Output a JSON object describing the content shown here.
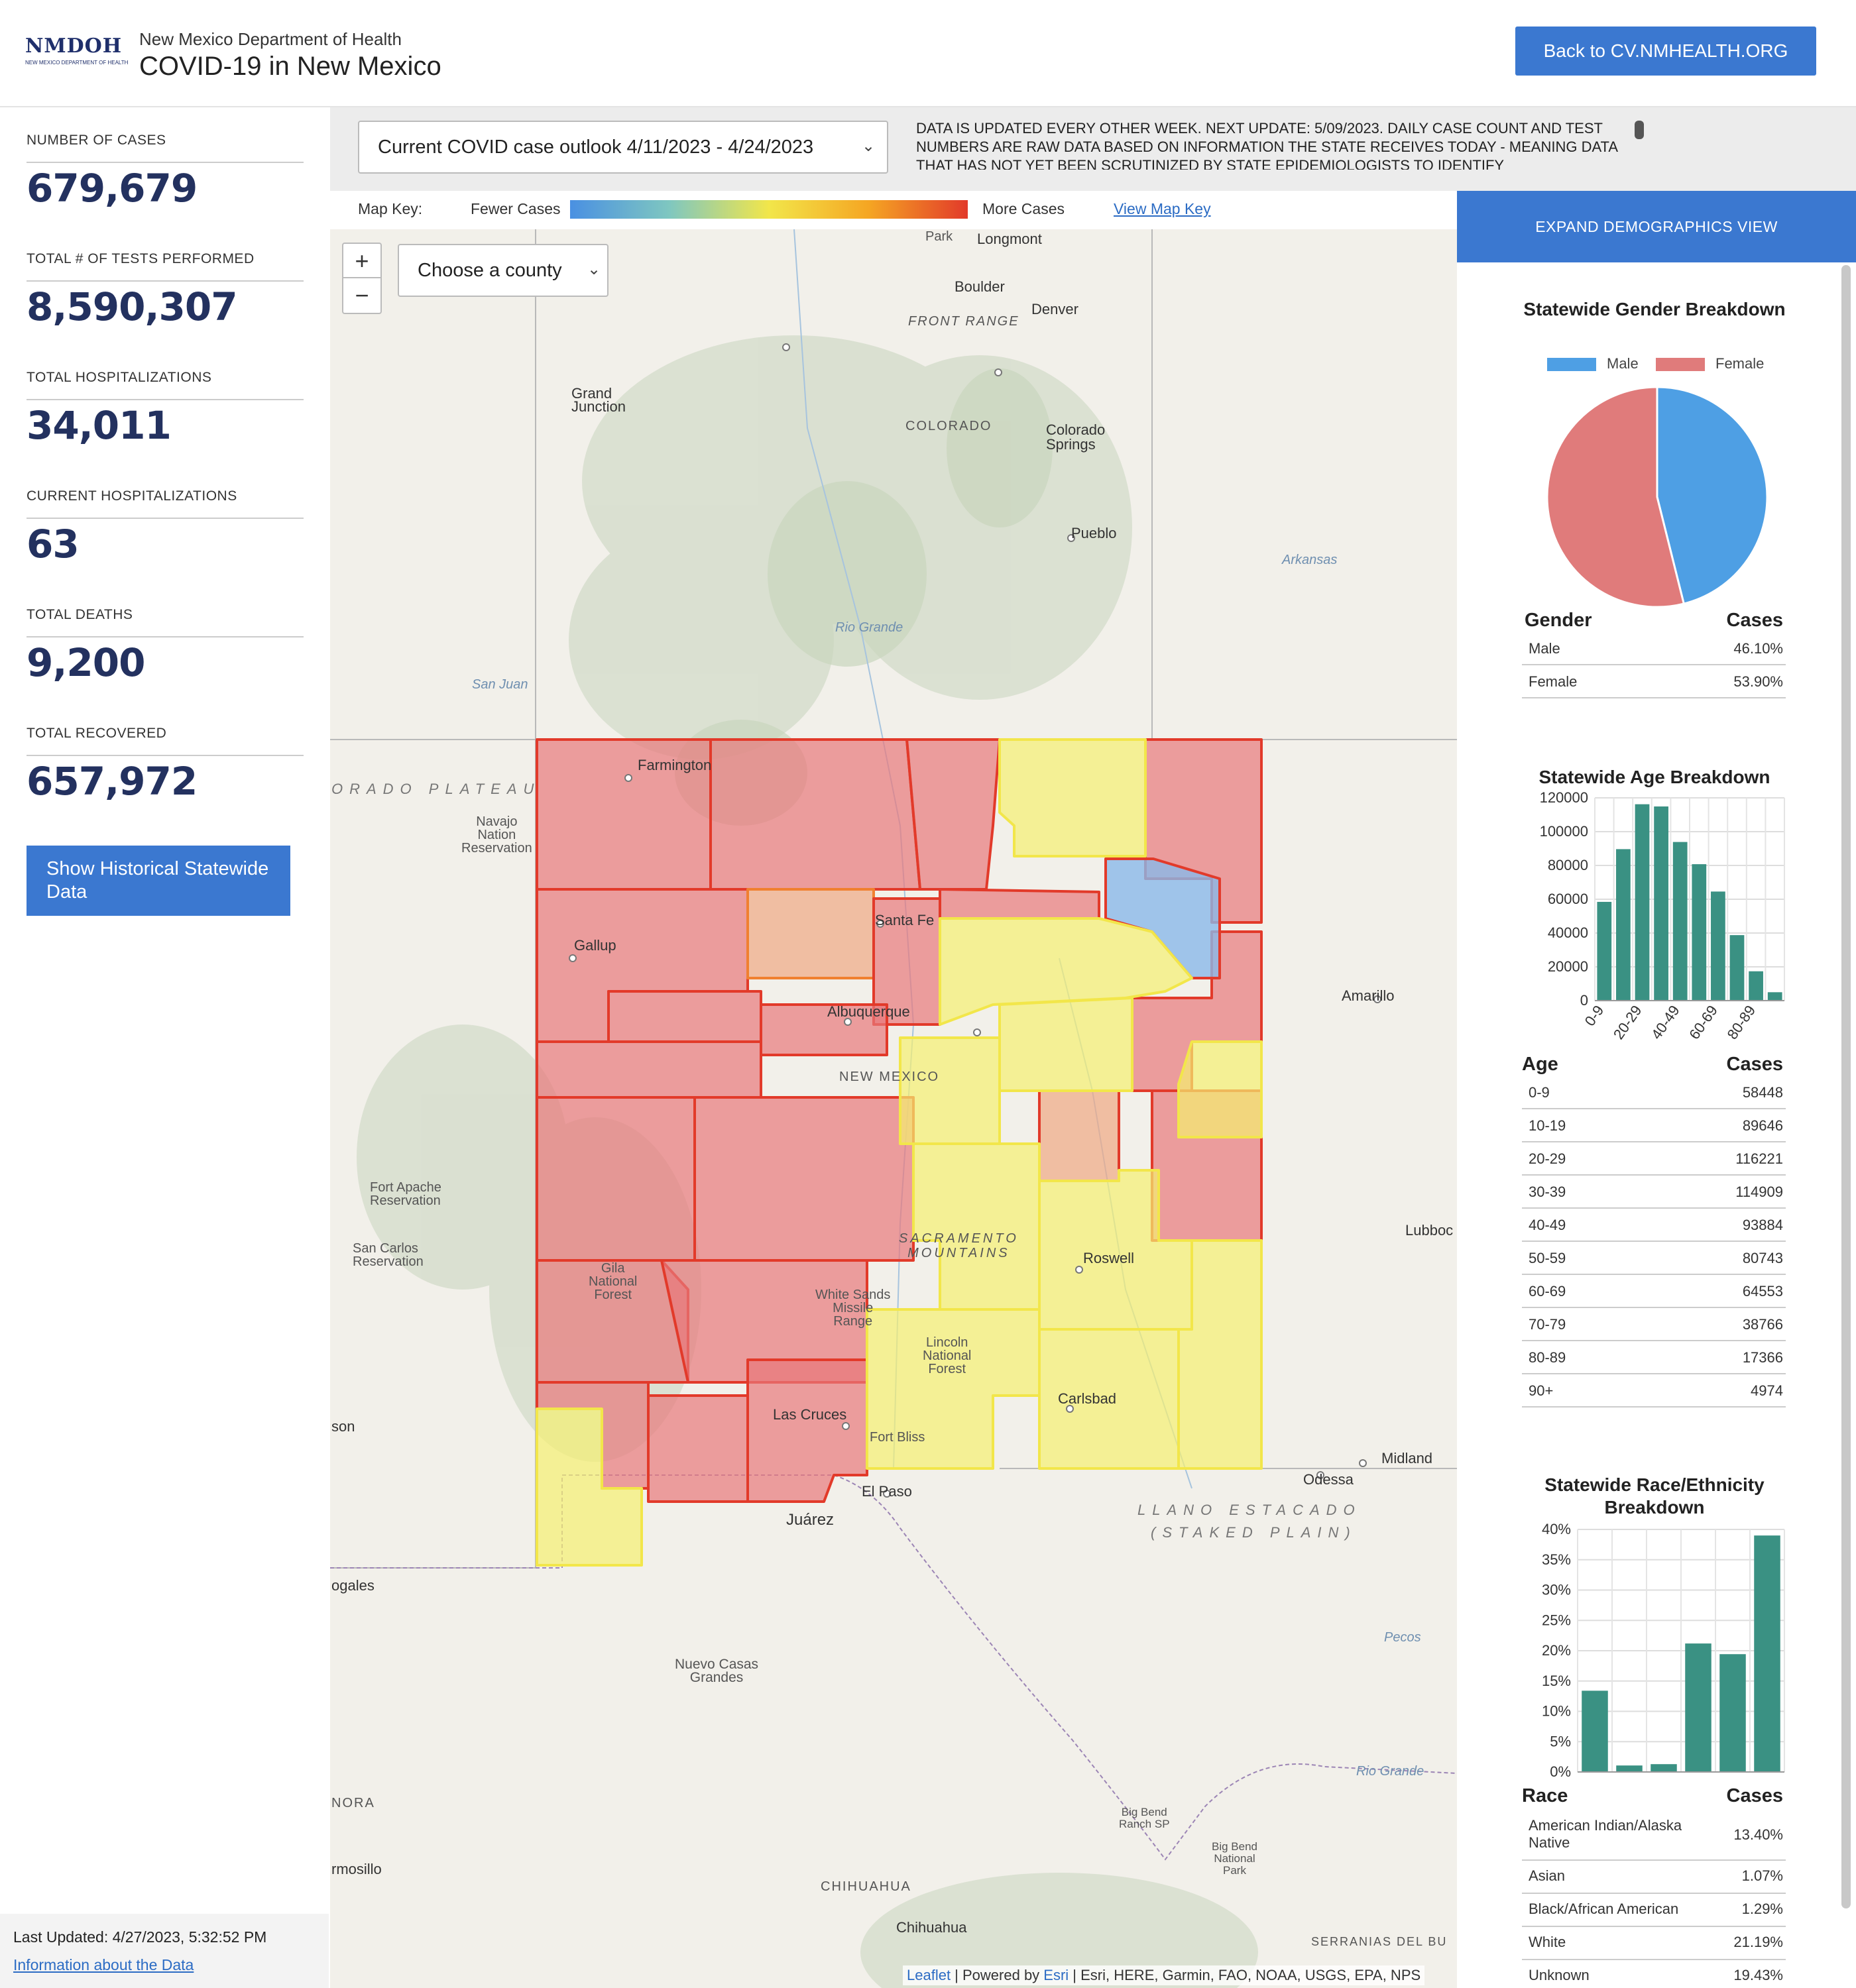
{
  "header": {
    "logo_text": "NMDOH",
    "logo_sub": "NEW MEXICO DEPARTMENT OF HEALTH",
    "dept": "New Mexico Department of Health",
    "title": "COVID-19 in New Mexico",
    "back_button": "Back to CV.NMHEALTH.ORG"
  },
  "stats": [
    {
      "label": "NUMBER OF CASES",
      "value": "679,679"
    },
    {
      "label": "TOTAL # OF TESTS PERFORMED",
      "value": "8,590,307"
    },
    {
      "label": "TOTAL HOSPITALIZATIONS",
      "value": "34,011"
    },
    {
      "label": "CURRENT HOSPITALIZATIONS",
      "value": "63"
    },
    {
      "label": "TOTAL DEATHS",
      "value": "9,200"
    },
    {
      "label": "TOTAL RECOVERED",
      "value": "657,972"
    }
  ],
  "historical_button": "Show Historical Statewide Data",
  "footer": {
    "last_updated": "Last Updated: 4/27/2023, 5:32:52 PM",
    "info_link": "Information about the Data"
  },
  "controls": {
    "outlook_selected": "Current COVID case outlook 4/11/2023 - 4/24/2023",
    "notice": "DATA IS UPDATED EVERY OTHER WEEK. NEXT UPDATE: 5/09/2023. DAILY CASE COUNT AND TEST NUMBERS ARE RAW DATA BASED ON INFORMATION THE STATE RECEIVES TODAY - MEANING DATA THAT HAS NOT YET BEEN SCRUTINIZED BY STATE EPIDEMIOLOGISTS TO IDENTIFY"
  },
  "map_key": {
    "label": "Map Key:",
    "fewer": "Fewer Cases",
    "more": "More Cases",
    "view_link": "View Map Key"
  },
  "map": {
    "county_select": "Choose a county",
    "zoom_in": "+",
    "zoom_out": "−",
    "attribution_leaflet": "Leaflet",
    "attribution_powered": " | Powered by ",
    "attribution_esri": "Esri",
    "attribution_rest": " | Esri, HERE, Garmin, FAO, NOAA, USGS, EPA, NPS",
    "labels": {
      "longmont": "Longmont",
      "boulder": "Boulder",
      "denver": "Denver",
      "grand_junction": "Grand\nJunction",
      "colorado": "COLORADO",
      "colorado_springs": "Colorado\nSprings",
      "pueblo": "Pueblo",
      "farmington": "Farmington",
      "gallup": "Gallup",
      "santa_fe": "Santa Fe",
      "albuquerque": "Albuquerque",
      "new_mexico": "NEW MEXICO",
      "roswell": "Roswell",
      "las_cruces": "Las Cruces",
      "carlsbad": "Carlsbad",
      "el_paso": "El Paso",
      "juarez": "Juárez",
      "amarillo": "Amarillo",
      "lubbock": "Lubboc",
      "midland": "Midland",
      "odessa": "Odessa",
      "chihuahua_state": "CHIHUAHUA",
      "chihuahua": "Chihuahua",
      "plateau": "ORADO  PLATEAU",
      "llano": "LLANO  ESTACADO",
      "staked": "(STAKED  PLAIN)",
      "sacramento": "SACRAMENTO\nMOUNTAINS",
      "nuevo_casas": "Nuevo Casas\nGrandes",
      "fort_bliss": "Fort Bliss",
      "front_range": "FRONT RANGE",
      "arkansas": "Arkansas",
      "rio_grande": "Rio Grande",
      "pecos": "Pecos",
      "san_juan": "San Juan",
      "navajo": "Navajo\nNation\nReservation",
      "sanora": "NORA",
      "nogales": "ogales",
      "hermosillo": "rmosillo",
      "serranias": "SERRANIAS DEL BU",
      "big_bend": "Big Bend\nRanch SP",
      "big_bend_np": "Big Bend\nNational\nPark",
      "gila": "Gila\nNational\nForest",
      "lincoln": "Lincoln\nNational\nForest",
      "fort_apache": "Fort Apache\nReservation",
      "san_carlos": "San Carlos\nReservation",
      "park": "Park",
      "tucson": "son",
      "white_sands": "White Sands\nMissile\nRange"
    }
  },
  "demographics": {
    "expand_button": "EXPAND DEMOGRAPHICS VIEW",
    "gender": {
      "title": "Statewide Gender Breakdown",
      "legend": [
        "Male",
        "Female"
      ],
      "col_label": "Gender",
      "col_value": "Cases",
      "rows": [
        {
          "label": "Male",
          "value": "46.10%"
        },
        {
          "label": "Female",
          "value": "53.90%"
        }
      ]
    },
    "age": {
      "title": "Statewide Age Breakdown",
      "col_label": "Age",
      "col_value": "Cases",
      "rows": [
        {
          "label": "0-9",
          "value": "58448"
        },
        {
          "label": "10-19",
          "value": "89646"
        },
        {
          "label": "20-29",
          "value": "116221"
        },
        {
          "label": "30-39",
          "value": "114909"
        },
        {
          "label": "40-49",
          "value": "93884"
        },
        {
          "label": "50-59",
          "value": "80743"
        },
        {
          "label": "60-69",
          "value": "64553"
        },
        {
          "label": "70-79",
          "value": "38766"
        },
        {
          "label": "80-89",
          "value": "17366"
        },
        {
          "label": "90+",
          "value": "4974"
        }
      ]
    },
    "race": {
      "title": "Statewide Race/Ethnicity Breakdown",
      "col_label": "Race",
      "col_value": "Cases",
      "rows": [
        {
          "label": "American Indian/Alaska Native",
          "value": "13.40%"
        },
        {
          "label": "Asian",
          "value": "1.07%"
        },
        {
          "label": "Black/African American",
          "value": "1.29%"
        },
        {
          "label": "White",
          "value": "21.19%"
        },
        {
          "label": "Unknown",
          "value": "19.43%"
        }
      ]
    }
  },
  "chart_data": [
    {
      "type": "pie",
      "title": "Statewide Gender Breakdown",
      "categories": [
        "Male",
        "Female"
      ],
      "values": [
        46.1,
        53.9
      ],
      "colors": [
        "#4e9fe4",
        "#e07b7b"
      ],
      "legend": "top"
    },
    {
      "type": "bar",
      "title": "Statewide Age Breakdown",
      "categories": [
        "0-9",
        "10-19",
        "20-29",
        "30-39",
        "40-49",
        "50-59",
        "60-69",
        "70-79",
        "80-89",
        "90+"
      ],
      "tick_labels": [
        "0-9",
        "20-29",
        "40-49",
        "60-69",
        "80-89"
      ],
      "values": [
        58448,
        89646,
        116221,
        114909,
        93884,
        80743,
        64553,
        38766,
        17366,
        4974
      ],
      "yticks": [
        "120000",
        "100000",
        "80000",
        "60000",
        "40000",
        "20000",
        "0"
      ],
      "ylim": [
        0,
        120000
      ],
      "color": "#3a9183",
      "grid": true
    },
    {
      "type": "bar",
      "title": "Statewide Race/Ethnicity Breakdown",
      "values": [
        13.4,
        1.07,
        1.29,
        21.19,
        19.43,
        39.0
      ],
      "yticks": [
        "40%",
        "35%",
        "30%",
        "25%",
        "20%",
        "15%",
        "10%",
        "5%",
        "0%"
      ],
      "ylim": [
        0,
        40
      ],
      "color": "#3a9183",
      "grid": true
    }
  ],
  "colors": {
    "accent": "#3b78d0",
    "stat_value": "#23315f",
    "bar": "#3a9183",
    "male": "#4e9fe4",
    "female": "#e07b7b",
    "county_red": "#e8787a",
    "county_yellow": "#f5ef70",
    "county_blue": "#8ab9ea",
    "county_orange": "#f0a883"
  }
}
